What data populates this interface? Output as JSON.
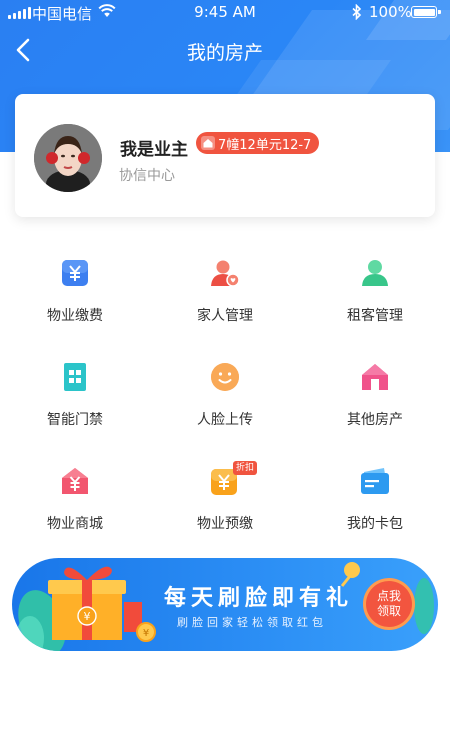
{
  "status_bar": {
    "carrier": "中国电信",
    "time": "9:45 AM",
    "battery": "100%"
  },
  "nav": {
    "title": "我的房产"
  },
  "profile": {
    "name": "我是业主",
    "room": "7幢12单元12-7",
    "community": "协信中心"
  },
  "menu": [
    {
      "label": "物业缴费",
      "icon": "yen-card-icon",
      "color": "#3d7ff0"
    },
    {
      "label": "家人管理",
      "icon": "family-icon",
      "color": "#f0625a"
    },
    {
      "label": "租客管理",
      "icon": "tenant-icon",
      "color": "#38c68a"
    },
    {
      "label": "智能门禁",
      "icon": "building-icon",
      "color": "#2bc4c9"
    },
    {
      "label": "人脸上传",
      "icon": "face-icon",
      "color": "#f79a44"
    },
    {
      "label": "其他房产",
      "icon": "house-icon",
      "color": "#f0528a"
    },
    {
      "label": "物业商城",
      "icon": "shop-icon",
      "color": "#f2566f"
    },
    {
      "label": "物业预缴",
      "icon": "prepay-icon",
      "color": "#f9a21b",
      "badge": "折扣"
    },
    {
      "label": "我的卡包",
      "icon": "wallet-icon",
      "color": "#2d9af0"
    }
  ],
  "banner": {
    "title": "每天刷脸即有礼",
    "subtitle": "刷脸回家轻松领取红包",
    "claim_line1": "点我",
    "claim_line2": "领取"
  }
}
